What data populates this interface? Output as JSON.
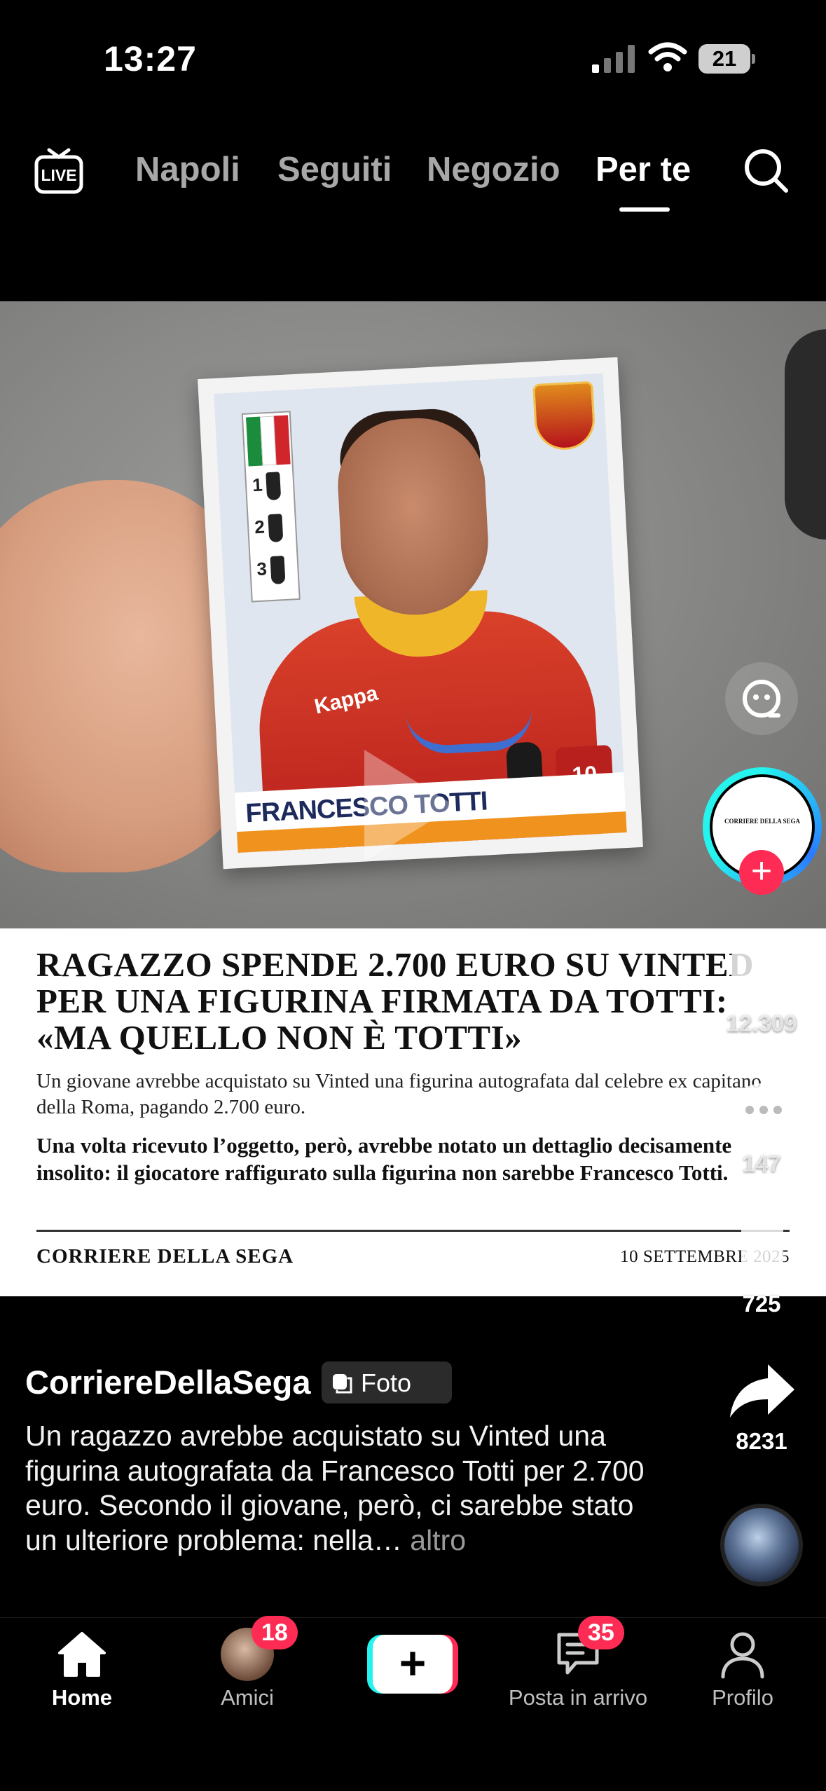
{
  "status_bar": {
    "time": "13:27",
    "battery": "21"
  },
  "top_nav": {
    "live_icon": "live-tv-icon",
    "tabs": [
      {
        "label": "Napoli",
        "active": false
      },
      {
        "label": "Seguiti",
        "active": false
      },
      {
        "label": "Negozio",
        "active": false
      },
      {
        "label": "Per te",
        "active": true
      }
    ],
    "search_icon": "search-icon"
  },
  "post": {
    "sticker": {
      "player_name": "FRANCESCO TOTTI",
      "brand": "Kappa",
      "shirt_number": "10",
      "cup_numbers": [
        "1",
        "2",
        "3"
      ]
    },
    "article": {
      "headline": "RAGAZZO SPENDE 2.700 EURO SU VINTED PER UNA FIGURINA FIRMATA DA TOTTI: «MA QUELLO NON È TOTTI»",
      "intro": "Un giovane avrebbe acquistato su Vinted una figurina autografata dal celebre ex capitano della Roma, pagando 2.700 euro.",
      "body": "Una volta ricevuto l’oggetto, però, avrebbe notato un dettaglio decisamente insolito: il giocatore raffigurato sulla figurina non sarebbe Francesco Totti.",
      "source": "CORRIERE DELLA SEGA",
      "date": "10 SETTEMBRE 2025"
    },
    "actions": {
      "likes": "12.309",
      "comments": "147",
      "saves": "725",
      "shares": "8231",
      "creator_avatar_text": "CORRIERE DELLA SEGA"
    },
    "caption": {
      "author": "CorriereDellaSega",
      "badge": "Foto",
      "text": "Un ragazzo avrebbe acquistato su Vinted una figurina autografata da Francesco Totti per 2.700 euro. Secondo il giovane, però, ci sarebbe stato un ulteriore problema: nella…",
      "more": "altro"
    }
  },
  "bottom_nav": {
    "items": [
      {
        "label": "Home",
        "icon": "home-icon",
        "active": true
      },
      {
        "label": "Amici",
        "icon": "friends-avatar",
        "badge": "18"
      },
      {
        "label": "",
        "icon": "create-plus-icon"
      },
      {
        "label": "Posta in arrivo",
        "icon": "inbox-icon",
        "badge": "35"
      },
      {
        "label": "Profilo",
        "icon": "profile-icon"
      }
    ]
  },
  "colors": {
    "accent_red": "#fe2c55",
    "accent_cyan": "#25f4ee",
    "background": "#000000"
  }
}
